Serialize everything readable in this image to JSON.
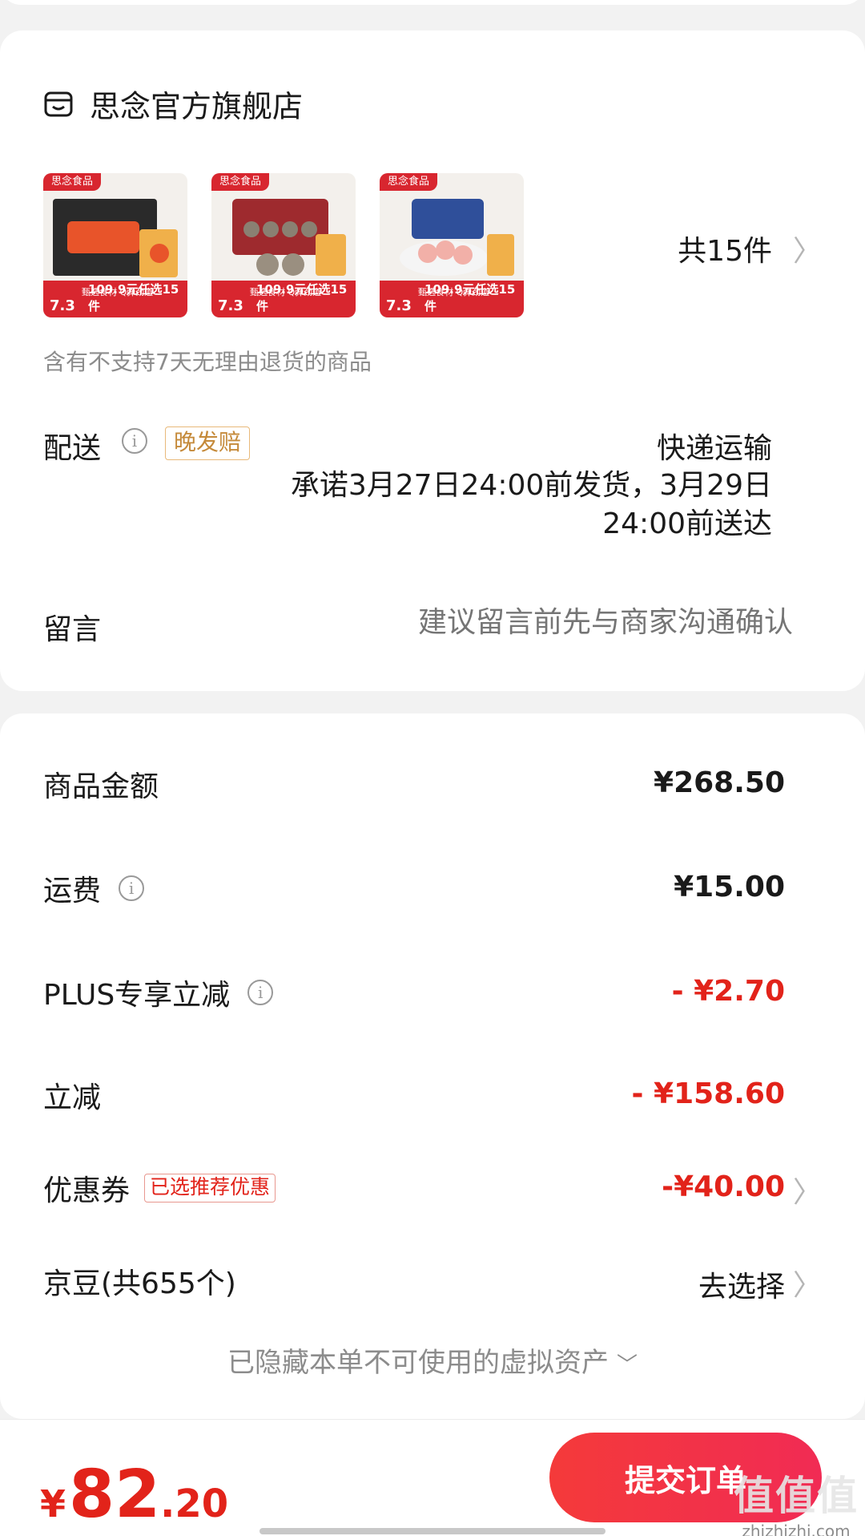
{
  "shop": {
    "name": "思念官方旗舰店",
    "items_count": "共15件",
    "products": [
      {
        "brand": "思念食品",
        "tag": "甄选食材 Q弹劲道",
        "price_a": "7.3",
        "price_b": "109.9元任选15件"
      },
      {
        "brand": "思念食品",
        "tag": "甄选食材 Q弹劲道",
        "price_a": "7.3",
        "price_b": "109.9元任选15件"
      },
      {
        "brand": "思念食品",
        "tag": "甄选食材 Q弹劲道",
        "price_a": "7.3",
        "price_b": "109.9元任选15件"
      }
    ],
    "return_notice": "含有不支持7天无理由退货的商品"
  },
  "shipping": {
    "label": "配送",
    "late_tag": "晚发赔",
    "method": "快递运输",
    "promise": "承诺3月27日24:00前发货，3月29日24:00前送达"
  },
  "message": {
    "label": "留言",
    "placeholder": "建议留言前先与商家沟通确认"
  },
  "price": {
    "goods_label": "商品金额",
    "goods_value": "¥268.50",
    "freight_label": "运费",
    "freight_value": "¥15.00",
    "plus_label": "PLUS专享立减",
    "plus_value": "- ¥2.70",
    "discount_label": "立减",
    "discount_value": "- ¥158.60",
    "coupon_label": "优惠券",
    "coupon_tag": "已选推荐优惠",
    "coupon_value": "-¥40.00",
    "beans_label": "京豆(共655个)",
    "beans_value": "去选择",
    "hidden_assets": "已隐藏本单不可使用的虚拟资产"
  },
  "bottom": {
    "currency": "¥",
    "total_int": "82",
    "total_dec": ".20",
    "submit_label": "提交订单"
  },
  "watermark": {
    "main": "值值值",
    "sub": "zhizhizhi.com"
  },
  "colors": {
    "accent_red": "#e2231a",
    "button_gradient": [
      "#f43a3a",
      "#f12b54"
    ]
  }
}
